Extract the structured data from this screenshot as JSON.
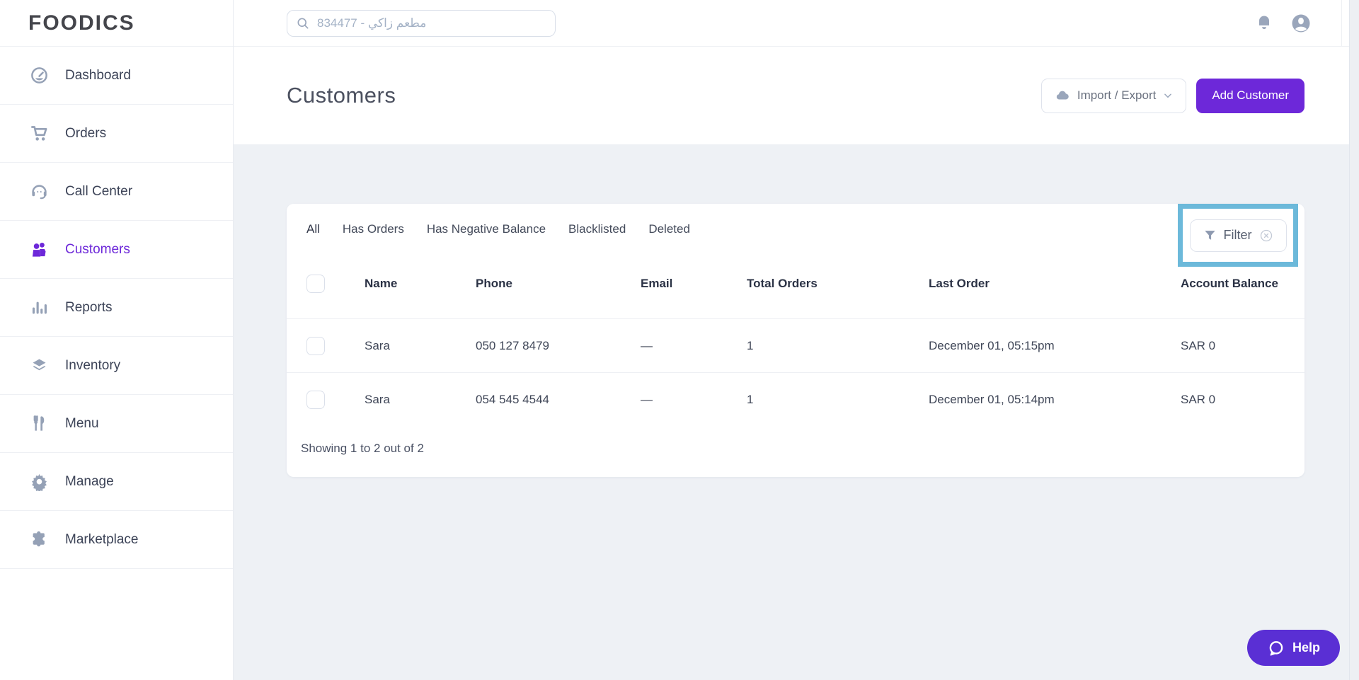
{
  "brand": {
    "logo_text": "FOODICS"
  },
  "topbar": {
    "search_value": "مطعم زاكي - 834477"
  },
  "sidebar": {
    "items": [
      {
        "label": "Dashboard",
        "icon": "dashboard-icon",
        "active": false
      },
      {
        "label": "Orders",
        "icon": "cart-icon",
        "active": false
      },
      {
        "label": "Call Center",
        "icon": "headset-icon",
        "active": false
      },
      {
        "label": "Customers",
        "icon": "customers-icon",
        "active": true
      },
      {
        "label": "Reports",
        "icon": "bar-chart-icon",
        "active": false
      },
      {
        "label": "Inventory",
        "icon": "layers-icon",
        "active": false
      },
      {
        "label": "Menu",
        "icon": "utensils-icon",
        "active": false
      },
      {
        "label": "Manage",
        "icon": "gear-icon",
        "active": false
      },
      {
        "label": "Marketplace",
        "icon": "puzzle-icon",
        "active": false
      }
    ]
  },
  "header": {
    "title": "Customers",
    "import_export_label": "Import / Export",
    "add_customer_label": "Add Customer"
  },
  "filters": {
    "tabs": [
      {
        "label": "All"
      },
      {
        "label": "Has Orders"
      },
      {
        "label": "Has Negative Balance"
      },
      {
        "label": "Blacklisted"
      },
      {
        "label": "Deleted"
      }
    ],
    "active_tab": "All",
    "filter_button_label": "Filter"
  },
  "table": {
    "columns": [
      {
        "label": "Name"
      },
      {
        "label": "Phone"
      },
      {
        "label": "Email"
      },
      {
        "label": "Total Orders"
      },
      {
        "label": "Last Order"
      },
      {
        "label": "Account Balance"
      }
    ],
    "rows": [
      {
        "name": "Sara",
        "phone": "050 127 8479",
        "email": "—",
        "total_orders": "1",
        "last_order": "December 01, 05:15pm",
        "account_balance": "SAR 0"
      },
      {
        "name": "Sara",
        "phone": "054 545 4544",
        "email": "—",
        "total_orders": "1",
        "last_order": "December 01, 05:14pm",
        "account_balance": "SAR 0"
      }
    ],
    "footer": "Showing 1 to 2 out of 2"
  },
  "help": {
    "label": "Help"
  },
  "colors": {
    "accent_purple": "#6d28d9",
    "help_purple": "#5a2fd4",
    "highlight_teal": "#6cb9da",
    "icon_gray": "#95a1b6",
    "background": "#eef1f5"
  }
}
